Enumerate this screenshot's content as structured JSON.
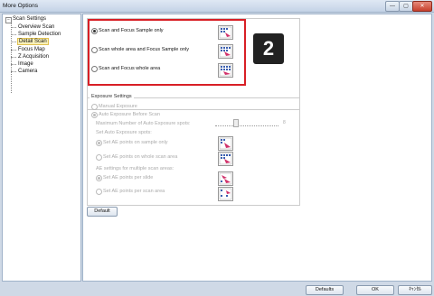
{
  "window": {
    "title": "More Options",
    "min": "—",
    "max": "▢",
    "close": "✕"
  },
  "tree": {
    "expander": "−",
    "root": "Scan Settings",
    "items": [
      "Overview Scan",
      "Sample Detection",
      "Detail Scan",
      "Focus Map",
      "Z Acquisition",
      "Image",
      "Camera"
    ]
  },
  "scan_area": {
    "options": [
      "Scan and Focus Sample only",
      "Scan whole area and Focus Sample only",
      "Scan and Focus whole area"
    ]
  },
  "callout": {
    "number": "2"
  },
  "exposure": {
    "legend": "Exposure Settings",
    "manual": "Manual Exposure",
    "auto": "Auto Exposure Before Scan",
    "max_spots": "Maximum Number of Auto Exposure spots:",
    "max_value": "8",
    "set_spots": "Set Auto Exposure spots:",
    "on_sample": "Set AE points on sample only",
    "on_whole": "Set AE points on whole scan area",
    "multiple": "AE settings for multiple scan areas:",
    "per_slide": "Set AE points per slide",
    "per_area": "Set AE points per scan area"
  },
  "buttons": {
    "default": "Default",
    "defaults": "Defaults",
    "ok": "OK",
    "cancel": "ｷｬﾝｾﾙ"
  },
  "colors": {
    "highlight": "#d81f26",
    "selection": "#f8f0b8"
  }
}
